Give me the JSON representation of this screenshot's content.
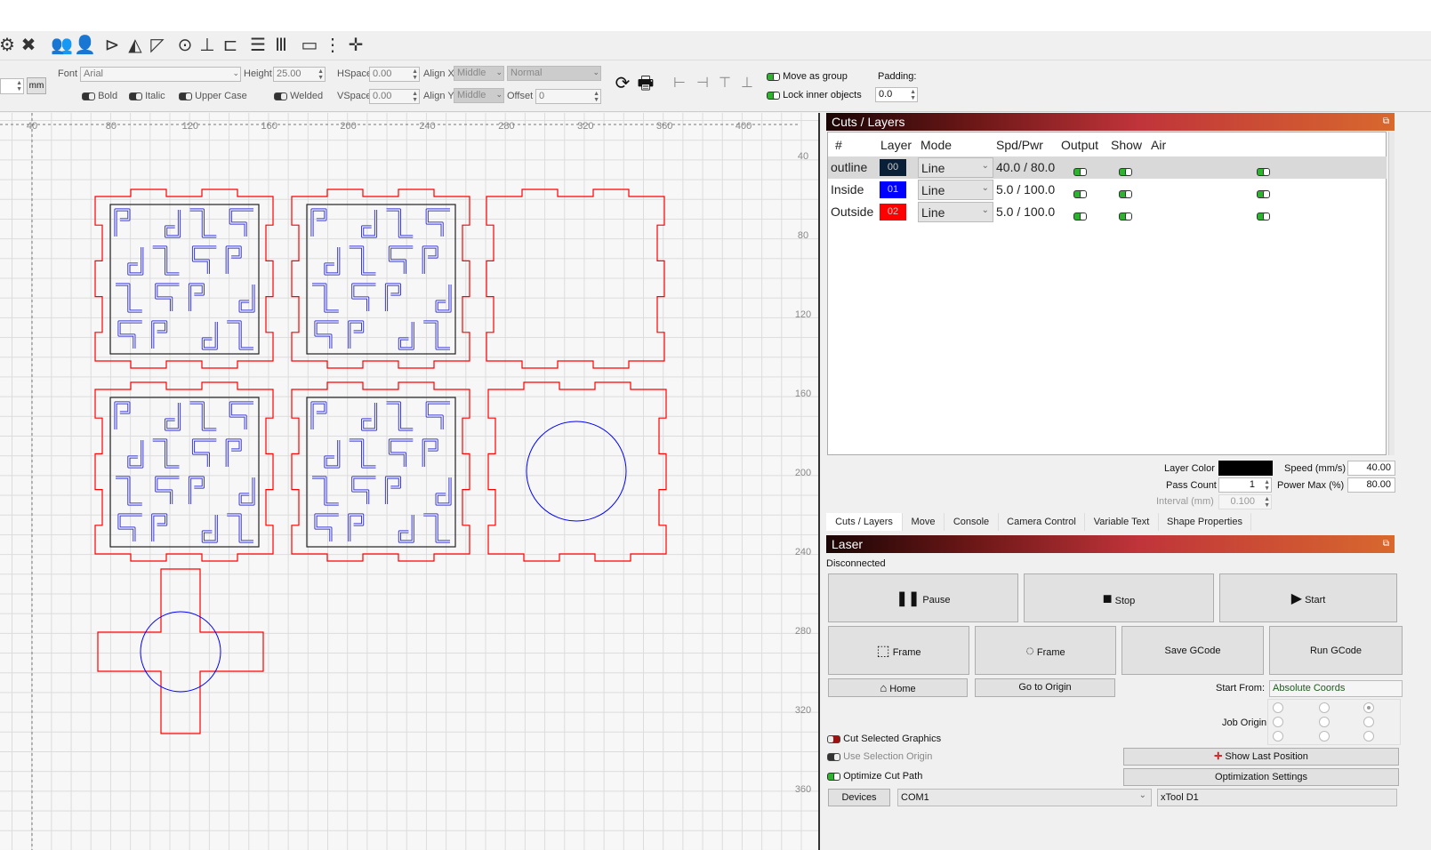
{
  "toolbar_main": {
    "icons": [
      "settings-gears-icon",
      "tools-wrench-icon",
      "group-users-icon",
      "user-icon",
      "mirror-horizontal-icon",
      "mirror-vertical-icon",
      "rotate-flip-icon",
      "target-origin-icon",
      "align-center-icon",
      "align-left-icon",
      "distribute-h-icon",
      "distribute-v-icon",
      "resize-h-icon",
      "resize-v-icon",
      "move-laser-icon"
    ]
  },
  "text_toolbar": {
    "unit": "mm",
    "font_label": "Font",
    "font_value": "Arial",
    "height_label": "Height",
    "height_value": "25.00",
    "hspace_label": "HSpace",
    "hspace_value": "0.00",
    "vspace_label": "VSpace",
    "vspace_value": "0.00",
    "alignx_label": "Align X",
    "alignx_value": "Middle",
    "aligny_label": "Align Y",
    "aligny_value": "Middle",
    "style_value": "Normal",
    "offset_label": "Offset",
    "offset_value": "0",
    "bold_label": "Bold",
    "italic_label": "Italic",
    "uppercase_label": "Upper Case",
    "welded_label": "Welded"
  },
  "arrange_toolbar": {
    "move_as_group": "Move as group",
    "lock_inner": "Lock inner objects",
    "padding_label": "Padding:",
    "padding_value": "0.0"
  },
  "rulers": {
    "top": [
      "40",
      "80",
      "120",
      "160",
      "200",
      "240",
      "280",
      "320",
      "360",
      "400"
    ],
    "right": [
      "40",
      "80",
      "120",
      "160",
      "200",
      "240",
      "280",
      "320",
      "360"
    ]
  },
  "colors": {
    "outline": "#0a1f3a",
    "inside": "#0000ff",
    "outside": "#ff0000",
    "toggle_on": "#2db32d"
  },
  "cuts_layers": {
    "title": "Cuts / Layers",
    "headers": [
      "#",
      "Layer",
      "Mode",
      "Spd/Pwr",
      "Output",
      "Show",
      "Air"
    ],
    "rows": [
      {
        "name": "outline",
        "layer": "00",
        "color": "#0a2038",
        "mode": "Line",
        "spdpwr": "40.0 / 80.0",
        "output": true,
        "show": true,
        "air": true
      },
      {
        "name": "Inside",
        "layer": "01",
        "color": "#0000ff",
        "mode": "Line",
        "spdpwr": "5.0 / 100.0",
        "output": true,
        "show": true,
        "air": true
      },
      {
        "name": "Outside",
        "layer": "02",
        "color": "#ff0000",
        "mode": "Line",
        "spdpwr": "5.0 / 100.0",
        "output": true,
        "show": true,
        "air": true
      }
    ],
    "props": {
      "layer_color_label": "Layer Color",
      "layer_color": "#000000",
      "pass_count_label": "Pass Count",
      "pass_count": "1",
      "interval_label": "Interval (mm)",
      "interval": "0.100",
      "speed_label": "Speed (mm/s)",
      "speed": "40.00",
      "power_label": "Power Max (%)",
      "power": "80.00"
    }
  },
  "tabs": [
    "Cuts / Layers",
    "Move",
    "Console",
    "Camera Control",
    "Variable Text",
    "Shape Properties"
  ],
  "laser": {
    "title": "Laser",
    "status": "Disconnected",
    "pause": "Pause",
    "stop": "Stop",
    "start": "Start",
    "frame1": "Frame",
    "frame2": "Frame",
    "save_gcode": "Save GCode",
    "run_gcode": "Run GCode",
    "home": "Home",
    "go_origin": "Go to Origin",
    "start_from_label": "Start From:",
    "start_from": "Absolute Coords",
    "job_origin_label": "Job Origin",
    "job_origin_selected": "top-right",
    "cut_selected": "Cut Selected Graphics",
    "use_selection_origin": "Use Selection Origin",
    "optimize_cut_path": "Optimize Cut Path",
    "show_last_position": "Show Last Position",
    "optimization_settings": "Optimization Settings",
    "devices": "Devices",
    "port": "COM1",
    "device": "xTool D1"
  }
}
